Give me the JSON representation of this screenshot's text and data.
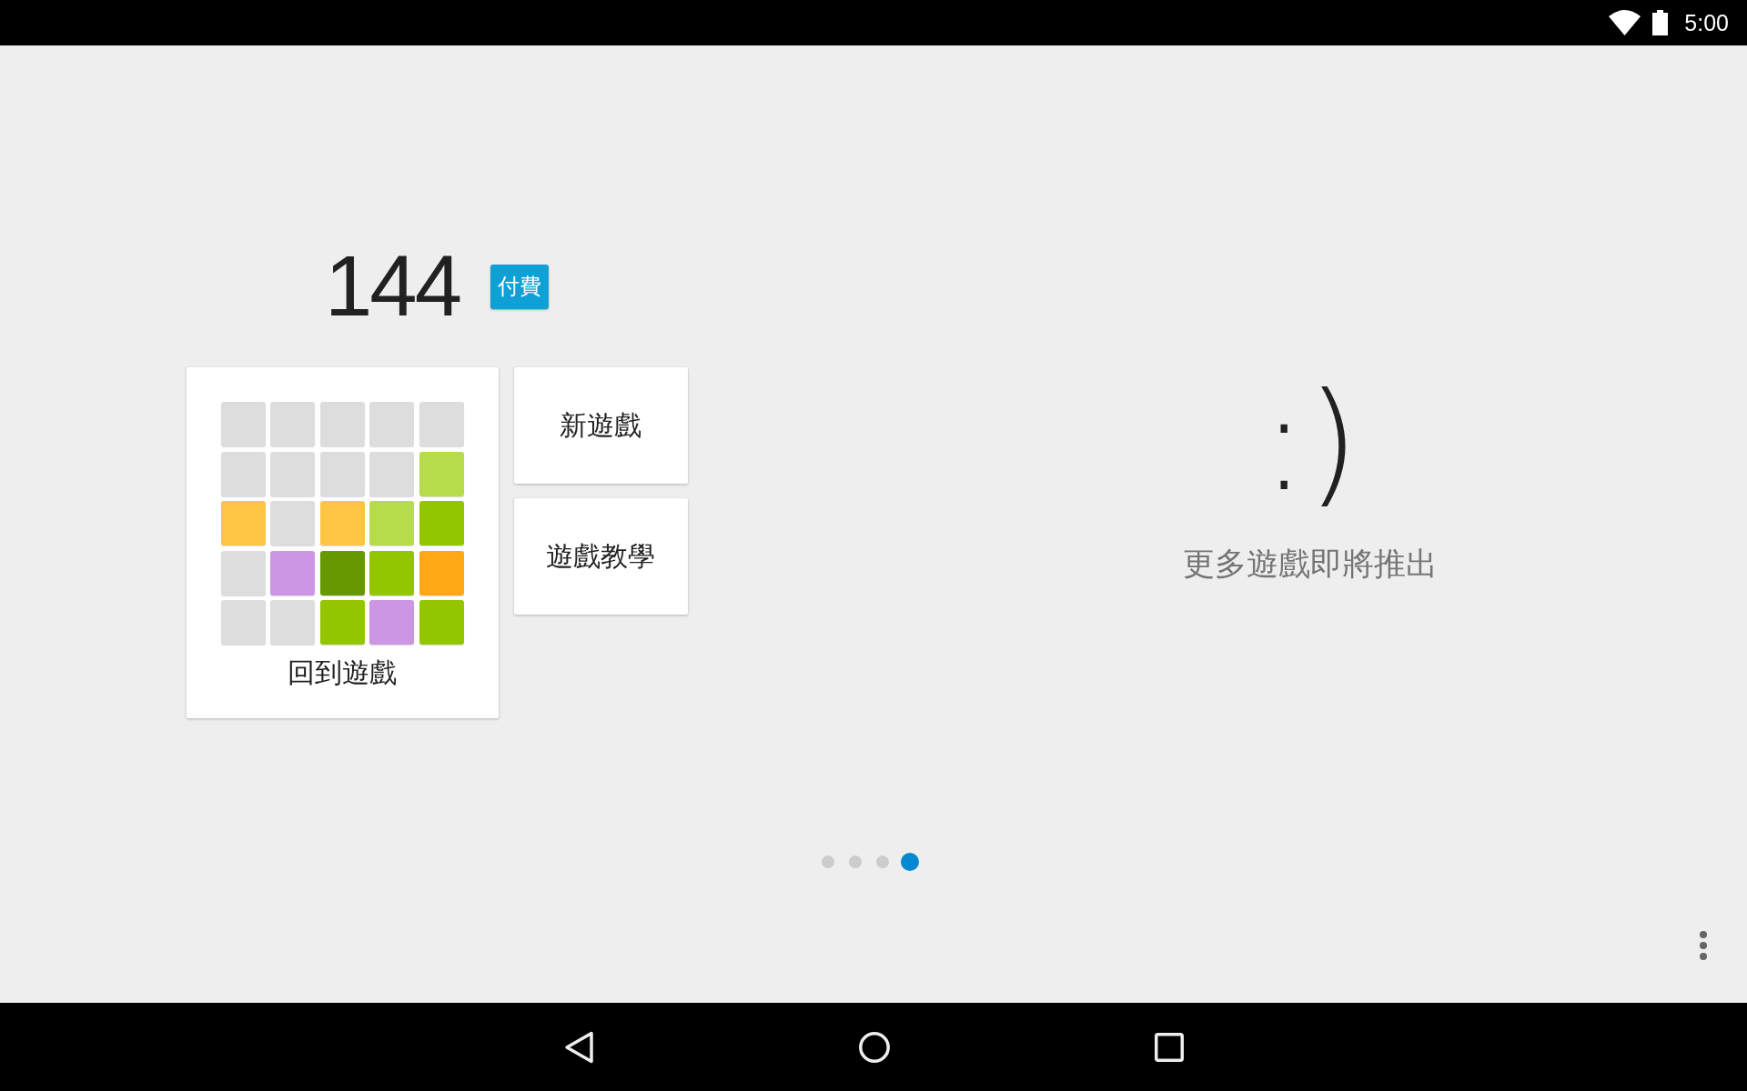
{
  "status_bar": {
    "time": "5:00"
  },
  "score": {
    "value": "144",
    "badge": "付費"
  },
  "resume_card": {
    "label": "回到遊戲",
    "board": [
      [
        {
          "color": "#dddddd"
        },
        {
          "color": "#dddddd"
        },
        {
          "color": "#dddddd"
        },
        {
          "color": "#dddddd"
        },
        {
          "color": "#dddddd"
        }
      ],
      [
        {
          "color": "#dddddd"
        },
        {
          "color": "#dddddd"
        },
        {
          "color": "#dddddd"
        },
        {
          "color": "#dddddd"
        },
        {
          "color": "#b6dc4c"
        }
      ],
      [
        {
          "color": "#fec544"
        },
        {
          "color": "#dddddd"
        },
        {
          "color": "#fec544"
        },
        {
          "color": "#b6dc4c"
        },
        {
          "color": "#94c600"
        }
      ],
      [
        {
          "color": "#dddddd"
        },
        {
          "color": "#cc96e4"
        },
        {
          "color": "#669900"
        },
        {
          "color": "#94c600"
        },
        {
          "color": "#ffa816"
        }
      ],
      [
        {
          "color": "#dddddd"
        },
        {
          "color": "#dddddd"
        },
        {
          "color": "#94c600"
        },
        {
          "color": "#cc96e4"
        },
        {
          "color": "#94c600"
        }
      ]
    ]
  },
  "buttons": [
    {
      "label": "新遊戲"
    },
    {
      "label": "遊戲教學"
    }
  ],
  "coming_soon": {
    "emoticon": ":)",
    "message": "更多遊戲即將推出"
  },
  "pager": [
    {
      "selected": false
    },
    {
      "selected": false
    },
    {
      "selected": false
    },
    {
      "selected": true
    }
  ]
}
